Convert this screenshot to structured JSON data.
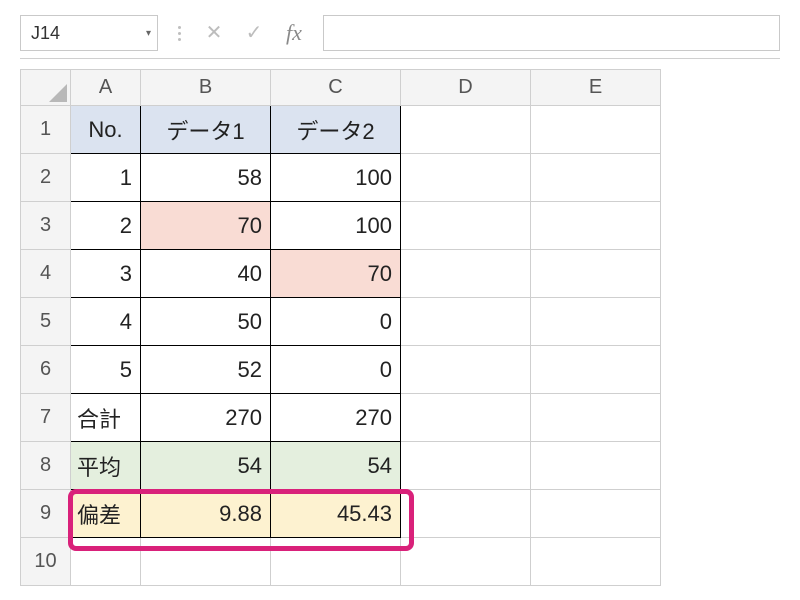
{
  "formula_bar": {
    "name_box_value": "J14",
    "formula_value": ""
  },
  "columns": [
    "A",
    "B",
    "C",
    "D",
    "E"
  ],
  "row_numbers": [
    "1",
    "2",
    "3",
    "4",
    "5",
    "6",
    "7",
    "8",
    "9",
    "10"
  ],
  "header_row": {
    "a": "No.",
    "b": "データ1",
    "c": "データ2"
  },
  "rows": [
    {
      "a": "1",
      "b": "58",
      "c": "100"
    },
    {
      "a": "2",
      "b": "70",
      "c": "100"
    },
    {
      "a": "3",
      "b": "40",
      "c": "70"
    },
    {
      "a": "4",
      "b": "50",
      "c": "0"
    },
    {
      "a": "5",
      "b": "52",
      "c": "0"
    }
  ],
  "totals": {
    "sum": {
      "label": "合計",
      "b": "270",
      "c": "270"
    },
    "avg": {
      "label": "平均",
      "b": "54",
      "c": "54"
    },
    "dev": {
      "label": "偏差",
      "b": "9.88",
      "c": "45.43"
    }
  },
  "icons": {
    "cancel": "✕",
    "enter": "✓",
    "fx": "fx",
    "dropdown": "▾"
  }
}
